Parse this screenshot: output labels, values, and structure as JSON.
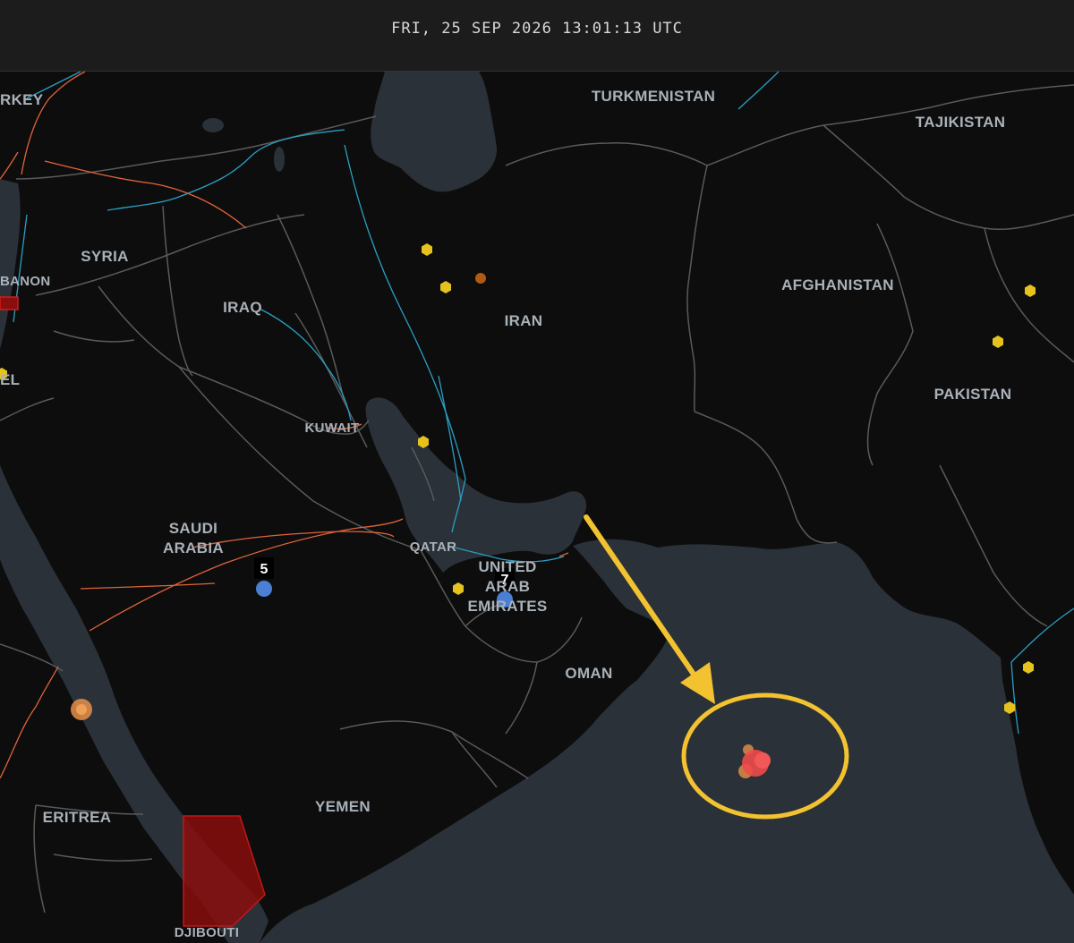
{
  "header": {
    "datetime": "FRI, 25 SEP 2026 13:01:13 UTC"
  },
  "countries": {
    "turkey": "RKEY",
    "syria": "SYRIA",
    "lebanon": "BANON",
    "israel": "EL",
    "iraq": "IRAQ",
    "kuwait": "KUWAIT",
    "iran": "IRAN",
    "turkmenistan": "TURKMENISTAN",
    "tajikistan": "TAJIKISTAN",
    "afghanistan": "AFGHANISTAN",
    "pakistan": "PAKISTAN",
    "saudi_line1": "SAUDI",
    "saudi_line2": "ARABIA",
    "qatar": "QATAR",
    "uae_line1": "UNITED",
    "uae_line2": "ARAB",
    "uae_line3": "EMIRATES",
    "oman": "OMAN",
    "yemen": "YEMEN",
    "eritrea": "ERITREA",
    "djibouti": "DJIBOUTI"
  },
  "clusters": [
    {
      "count": "5"
    },
    {
      "count": "7"
    }
  ],
  "colors": {
    "land": "#0d0d0d",
    "water": "#2b3138",
    "border": "#5a5a5a",
    "flight_blue": "#2a9fc4",
    "flight_orange": "#e0643a",
    "event_yellow": "#e6c21f",
    "highlight": "#f2c230",
    "hotspot": "#f04a4a",
    "restricted_zone": "#8a0e0e",
    "cluster_blue": "#4a7fd4"
  }
}
